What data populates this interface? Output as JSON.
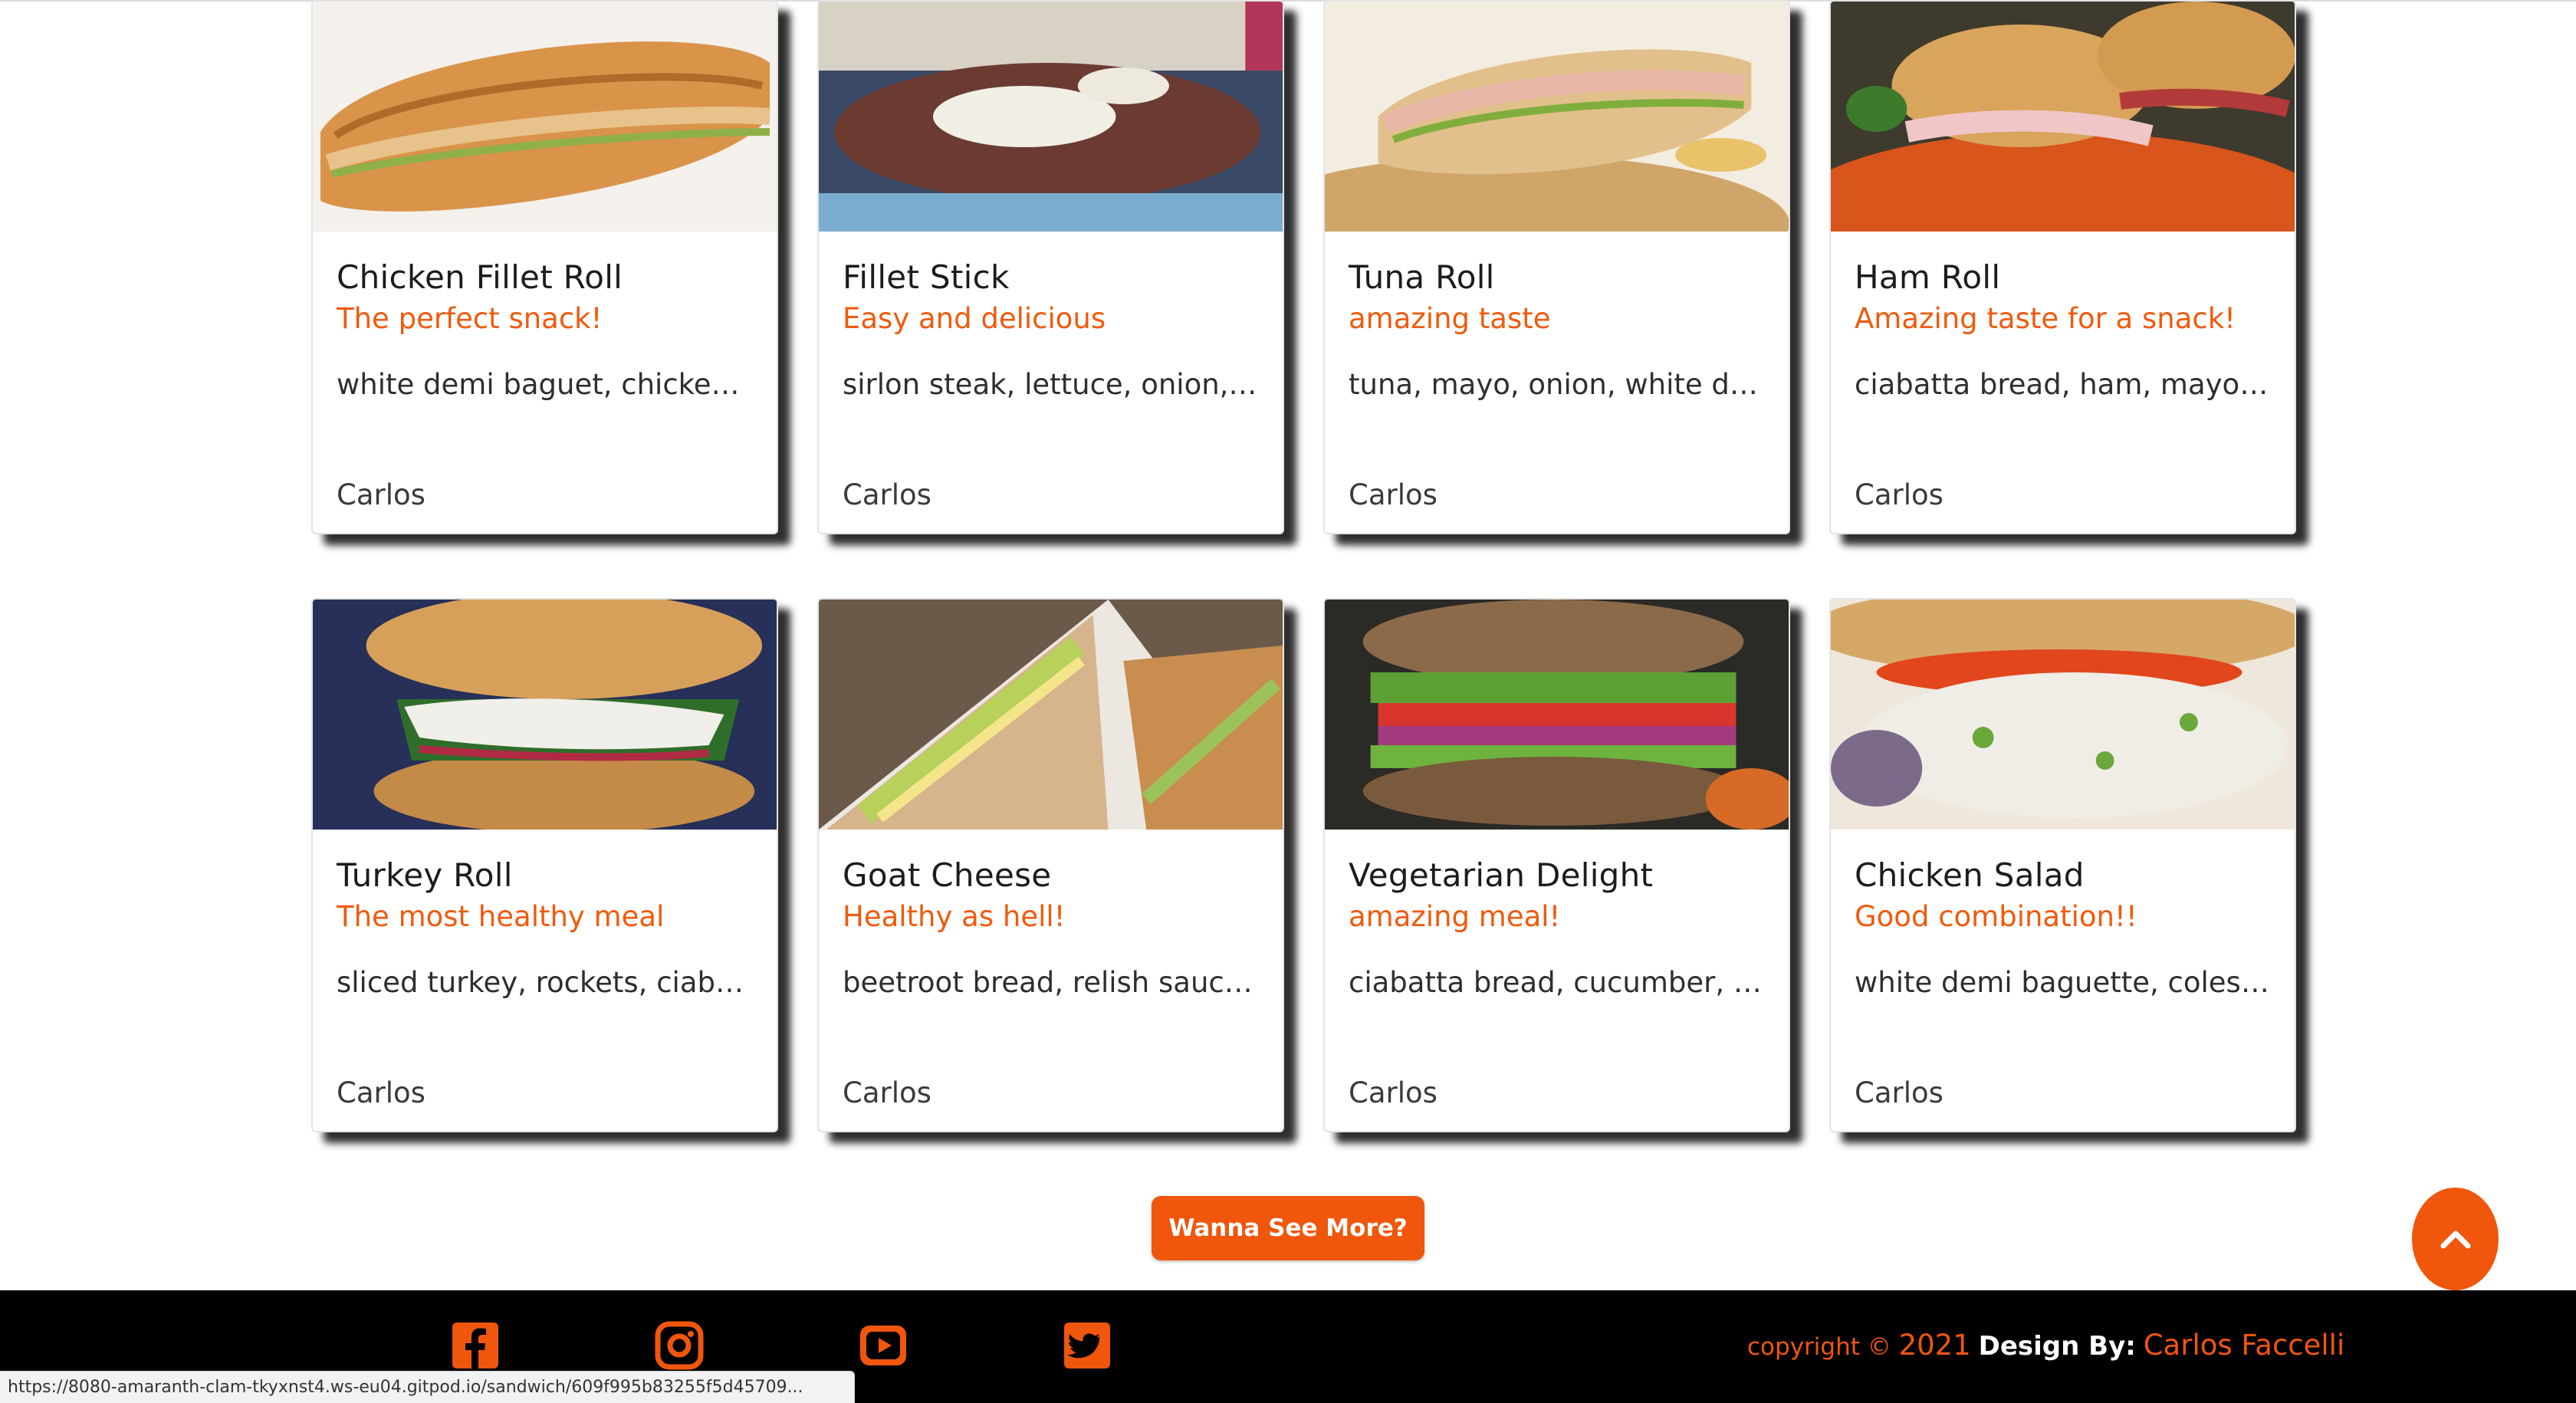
{
  "cards": [
    {
      "name": "Chicken Fillet Roll",
      "tagline": "The perfect snack!",
      "ingredients": "white demi baguet, chicken ...",
      "author": "Carlos"
    },
    {
      "name": "Fillet Stick",
      "tagline": "Easy and delicious",
      "ingredients": "sirlon steak, lettuce, onion, bl...",
      "author": "Carlos"
    },
    {
      "name": "Tuna Roll",
      "tagline": "amazing taste",
      "ingredients": "tuna, mayo, onion, white de...",
      "author": "Carlos"
    },
    {
      "name": "Ham Roll",
      "tagline": "Amazing taste for a snack!",
      "ingredients": "ciabatta bread, ham, mayo, ...",
      "author": "Carlos"
    },
    {
      "name": "Turkey Roll",
      "tagline": "The most healthy meal",
      "ingredients": "sliced turkey, rockets, ciabatt...",
      "author": "Carlos"
    },
    {
      "name": "Goat Cheese",
      "tagline": "Healthy as hell!",
      "ingredients": "beetroot bread, relish sauce, ...",
      "author": "Carlos"
    },
    {
      "name": "Vegetarian Delight",
      "tagline": "amazing meal!",
      "ingredients": "ciabatta bread, cucumber, to...",
      "author": "Carlos"
    },
    {
      "name": "Chicken Salad",
      "tagline": "Good combination!!",
      "ingredients": "white demi baguette, colesla...",
      "author": "Carlos"
    }
  ],
  "more_button": "Wanna See More?",
  "footer": {
    "social": [
      "facebook-icon",
      "instagram-icon",
      "youtube-icon",
      "twitter-icon"
    ],
    "copyright_prefix": "copyright ©",
    "year": "2021",
    "design_by": "Design By:",
    "author": "Carlos Faccelli"
  },
  "status_url": "https://8080-amaranth-clam-tkyxnst4.ws-eu04.gitpod.io/sandwich/609f995b83255f5d45709...",
  "colors": {
    "accent": "#f0560c",
    "footer_bg": "#000000"
  }
}
